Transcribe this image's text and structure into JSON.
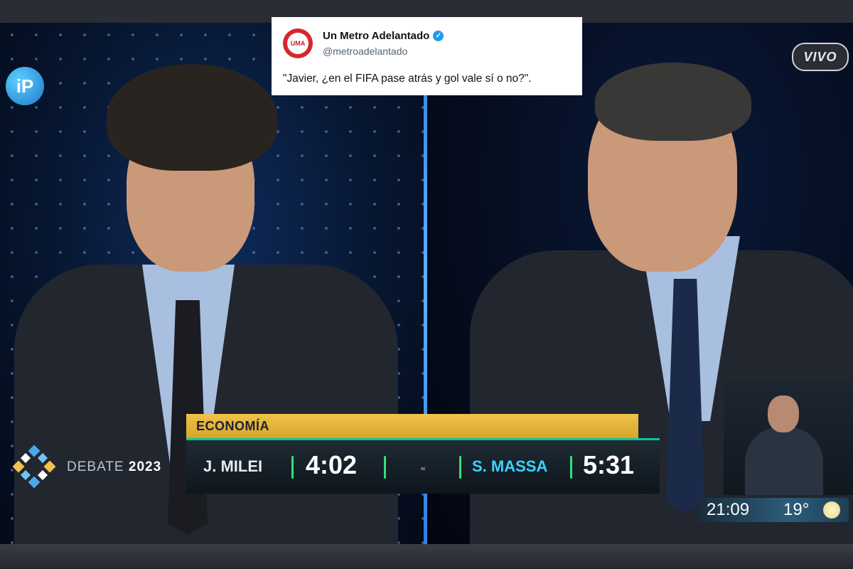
{
  "tweet": {
    "name": "Un Metro Adelantado",
    "handle": "@metroadelantado",
    "text": "\"Javier, ¿en el FIFA pase atrás y gol vale sí o no?\".",
    "avatar_text": "UMA"
  },
  "broadcast": {
    "channel_logo": "iP",
    "live_label": "VIVO",
    "debate_label_word": "DEBATE",
    "debate_label_year": "2023",
    "topic": "ECONOMÍA",
    "candidates": [
      {
        "name": "J. MILEI",
        "time": "4:02"
      },
      {
        "name": "S. MASSA",
        "time": "5:31"
      }
    ],
    "clock": "21:09",
    "temperature": "19°",
    "weather_icon": "sun-icon"
  },
  "colors": {
    "topic_bar": "#e2b03a",
    "accent_green": "#36e07a",
    "candidate2": "#3bd4ff",
    "divider": "#4a9af0"
  }
}
